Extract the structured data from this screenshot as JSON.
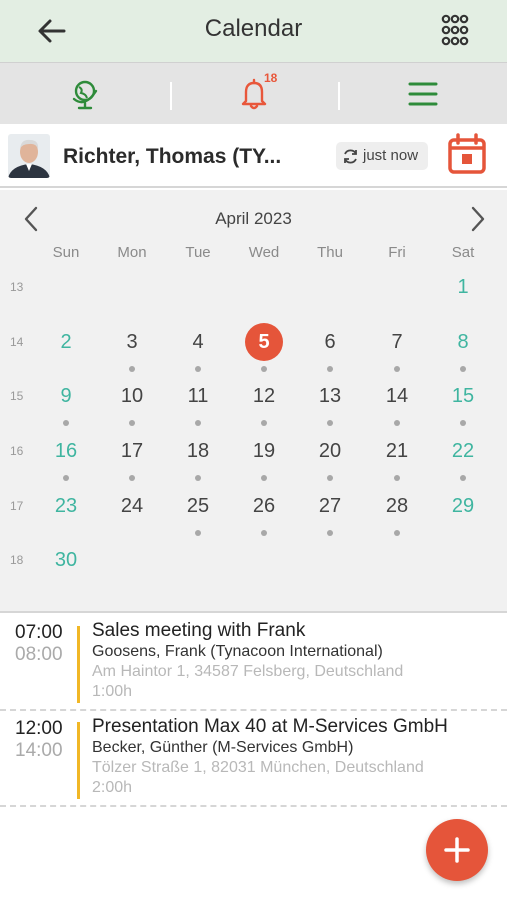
{
  "header": {
    "title": "Calendar",
    "back_icon": "arrow-left-icon",
    "menu_icon": "apps-grid-icon"
  },
  "tabs": [
    {
      "icon": "globe-icon",
      "color": "#2e8b3a"
    },
    {
      "icon": "bell-icon",
      "color": "#e8573b",
      "badge": "18"
    },
    {
      "icon": "hamburger-menu-icon",
      "color": "#2e8b3a"
    }
  ],
  "user": {
    "name": "Richter, Thomas (TY...",
    "sync_text": "just now"
  },
  "calendar": {
    "month": "April",
    "year": "2023",
    "weekdays": [
      "Sun",
      "Mon",
      "Tue",
      "Wed",
      "Thu",
      "Fri",
      "Sat"
    ],
    "weeks": [
      {
        "num": "13",
        "days": [
          "",
          "",
          "",
          "",
          "",
          "",
          "1"
        ],
        "dots": [
          0,
          0,
          0,
          0,
          0,
          0,
          0
        ]
      },
      {
        "num": "14",
        "days": [
          "2",
          "3",
          "4",
          "5",
          "6",
          "7",
          "8"
        ],
        "dots": [
          0,
          1,
          1,
          1,
          1,
          1,
          1
        ]
      },
      {
        "num": "15",
        "days": [
          "9",
          "10",
          "11",
          "12",
          "13",
          "14",
          "15"
        ],
        "dots": [
          1,
          1,
          1,
          1,
          1,
          1,
          1
        ]
      },
      {
        "num": "16",
        "days": [
          "16",
          "17",
          "18",
          "19",
          "20",
          "21",
          "22"
        ],
        "dots": [
          1,
          1,
          1,
          1,
          1,
          1,
          1
        ]
      },
      {
        "num": "17",
        "days": [
          "23",
          "24",
          "25",
          "26",
          "27",
          "28",
          "29"
        ],
        "dots": [
          0,
          0,
          1,
          1,
          1,
          1,
          0
        ]
      },
      {
        "num": "18",
        "days": [
          "30",
          "",
          "",
          "",
          "",
          "",
          ""
        ],
        "dots": [
          0,
          0,
          0,
          0,
          0,
          0,
          0
        ]
      }
    ],
    "selected_day": "5",
    "colors": {
      "weekend": "#3fb5a0",
      "today": "#e5553a",
      "dot": "#a8a8a8"
    }
  },
  "events": [
    {
      "start": "07:00",
      "end": "08:00",
      "title": "Sales meeting with Frank",
      "contact": "Goosens, Frank (Tynacoon International)",
      "address": "Am Haintor 1, 34587 Felsberg, Deutschland",
      "duration": "1:00h"
    },
    {
      "start": "12:00",
      "end": "14:00",
      "title": "Presentation Max 40 at M-Services GmbH",
      "contact": "Becker, Günther (M-Services GmbH)",
      "address": "Tölzer Straße 1, 82031 München, Deutschland",
      "duration": "2:00h"
    }
  ],
  "fab": {
    "icon": "plus-icon"
  },
  "colors": {
    "accent": "#e5553a",
    "green": "#2e8b3a",
    "event_bar": "#f1b726"
  }
}
